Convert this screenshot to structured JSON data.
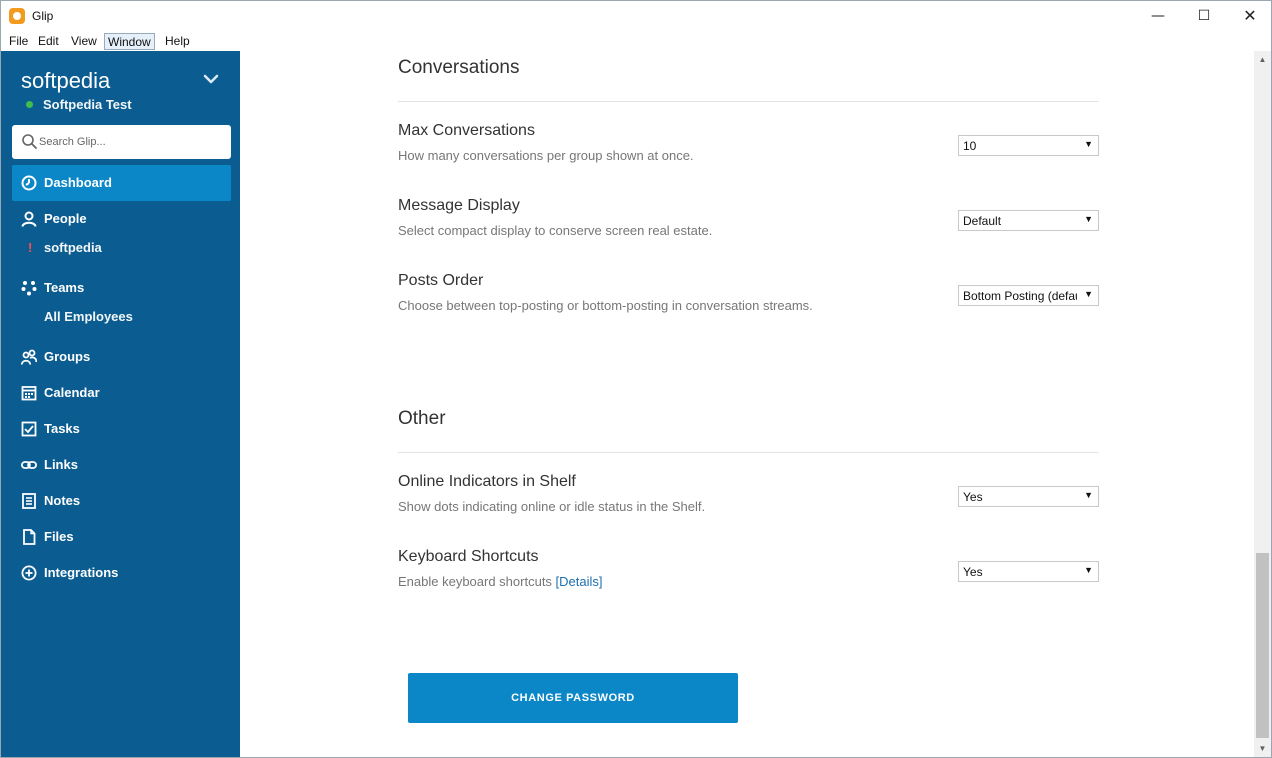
{
  "window": {
    "title": "Glip",
    "minimize_icon": "minimize-icon",
    "maximize_icon": "maximize-icon",
    "close_icon": "close-icon",
    "minimize_glyph": "—",
    "maximize_glyph": "☐",
    "close_glyph": "✕"
  },
  "menu": {
    "file": "File",
    "edit": "Edit",
    "view": "View",
    "window": "Window",
    "help": "Help"
  },
  "sidebar": {
    "company": "softpedia",
    "user": "Softpedia Test",
    "status_color": "#3fbf4a",
    "search": {
      "placeholder": "Search Glip..."
    },
    "items": [
      {
        "label": "Dashboard",
        "icon": "dashboard-icon",
        "active": true
      },
      {
        "label": "People",
        "icon": "person-icon"
      },
      {
        "label": "Teams",
        "icon": "teams-icon"
      },
      {
        "label": "Groups",
        "icon": "groups-icon"
      },
      {
        "label": "Calendar",
        "icon": "calendar-icon"
      },
      {
        "label": "Tasks",
        "icon": "checkbox-icon"
      },
      {
        "label": "Links",
        "icon": "link-icon"
      },
      {
        "label": "Notes",
        "icon": "notes-icon"
      },
      {
        "label": "Files",
        "icon": "file-icon"
      },
      {
        "label": "Integrations",
        "icon": "plus-circle-icon"
      }
    ],
    "people_sub": {
      "alert": "!",
      "name": "softpedia"
    },
    "teams_sub": {
      "name": "All Employees"
    }
  },
  "main": {
    "conversations": {
      "title": "Conversations",
      "settings": [
        {
          "label": "Max Conversations",
          "desc": "How many conversations per group shown at once.",
          "value": "10"
        },
        {
          "label": "Message Display",
          "desc": "Select compact display to conserve screen real estate.",
          "value": "Default"
        },
        {
          "label": "Posts Order",
          "desc": "Choose between top-posting or bottom-posting in conversation streams.",
          "value": "Bottom Posting (default)"
        }
      ]
    },
    "other": {
      "title": "Other",
      "settings": [
        {
          "label": "Online Indicators in Shelf",
          "desc": "Show dots indicating online or idle status in the Shelf.",
          "value": "Yes"
        },
        {
          "label": "Keyboard Shortcuts",
          "desc": "Enable keyboard shortcuts ",
          "link": "[Details]",
          "value": "Yes"
        }
      ]
    },
    "change_password": "CHANGE PASSWORD"
  },
  "colors": {
    "sidebar": "#0b5d91",
    "active": "#0b87c8",
    "button": "#0b87c8",
    "link": "#1c6fb0"
  }
}
